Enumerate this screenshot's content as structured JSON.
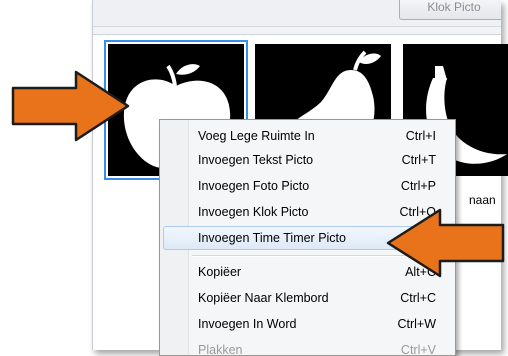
{
  "toolbar": {
    "klok_button_label": "Klok Picto"
  },
  "tiles": [
    {
      "name": "apple"
    },
    {
      "name": "pear"
    },
    {
      "name": "banana",
      "caption_visible": "naan"
    }
  ],
  "context_menu": {
    "items": [
      {
        "label": "Voeg Lege Ruimte In",
        "shortcut": "Ctrl+I"
      },
      {
        "label": "Invoegen Tekst Picto",
        "shortcut": "Ctrl+T"
      },
      {
        "label": "Invoegen Foto Picto",
        "shortcut": "Ctrl+P"
      },
      {
        "label": "Invoegen Klok Picto",
        "shortcut": "Ctrl+O"
      },
      {
        "label": "Invoegen Time Timer Picto",
        "shortcut": "",
        "highlighted": true
      },
      {
        "label": "Kopiëer",
        "shortcut": "Alt+C"
      },
      {
        "label": "Kopiëer Naar Klembord",
        "shortcut": "Ctrl+C"
      },
      {
        "label": "Invoegen In Word",
        "shortcut": "Ctrl+W"
      },
      {
        "label": "Plakken",
        "shortcut": "Ctrl+V",
        "disabled": true
      }
    ]
  },
  "colors": {
    "arrow": "#e8731a",
    "selection": "#3a8ee6",
    "highlight_border": "#aecbef"
  }
}
